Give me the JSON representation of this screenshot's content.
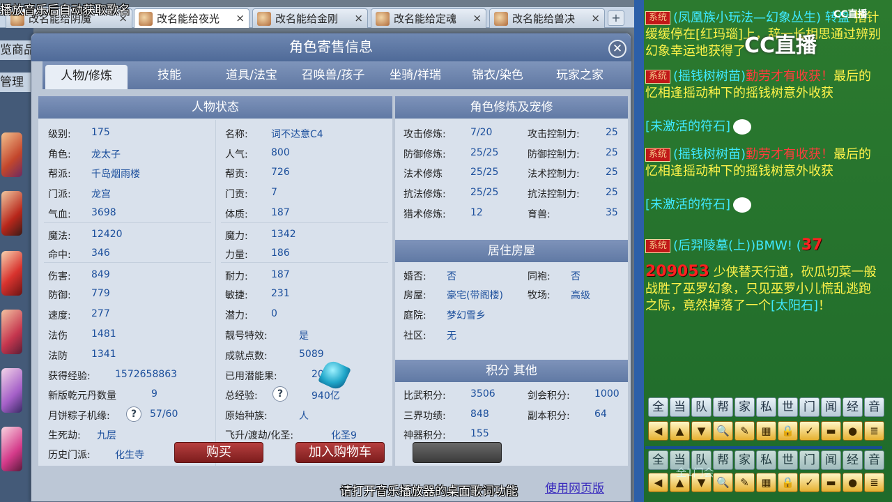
{
  "overlay": {
    "top_text": "播放音乐后自动获取歌名",
    "bottom_text": "请打开音乐播放器的桌面歌词功能"
  },
  "browser": {
    "tabs": [
      {
        "label": "改名能给阴魔"
      },
      {
        "label": "改名能给夜光"
      },
      {
        "label": "改名能给金刚"
      },
      {
        "label": "改名能给定魂"
      },
      {
        "label": "改名能给兽决"
      }
    ],
    "new_tab": "+",
    "close": "×"
  },
  "left_partial": {
    "label1": "览商品",
    "label2": "管理"
  },
  "dialog": {
    "title": "角色寄售信息",
    "close": "✕",
    "tabs": [
      "人物/修炼",
      "技能",
      "道具/法宝",
      "召唤兽/孩子",
      "坐骑/祥瑞",
      "锦衣/染色",
      "玩家之家"
    ],
    "status_header": "人物状态",
    "status_left": [
      {
        "label": "级别:",
        "value": "175"
      },
      {
        "label": "角色:",
        "value": "龙太子"
      },
      {
        "label": "帮派:",
        "value": "千岛烟雨楼"
      },
      {
        "label": "门派:",
        "value": "龙宫"
      },
      {
        "label": "气血:",
        "value": "3698"
      },
      {
        "label": "魔法:",
        "value": "12420"
      },
      {
        "label": "命中:",
        "value": "346"
      },
      {
        "label": "伤害:",
        "value": "849"
      },
      {
        "label": "防御:",
        "value": "779"
      },
      {
        "label": "速度:",
        "value": "277"
      },
      {
        "label": "法伤",
        "value": "1481"
      },
      {
        "label": "法防",
        "value": "1341"
      },
      {
        "label": "获得经验:",
        "value": "1572658863"
      },
      {
        "label": "新版乾元丹数量",
        "value": "9"
      },
      {
        "label": "月饼粽子机缘:",
        "value": "57/60"
      },
      {
        "label": "生死劫:",
        "value": "九层"
      },
      {
        "label": "历史门派:",
        "value": "化生寺"
      }
    ],
    "status_right": [
      {
        "label": "名称:",
        "value": "词不达意C4"
      },
      {
        "label": "人气:",
        "value": "800"
      },
      {
        "label": "帮贡:",
        "value": "726"
      },
      {
        "label": "门贡:",
        "value": "7"
      },
      {
        "label": "体质:",
        "value": "187"
      },
      {
        "label": "魔力:",
        "value": "1342"
      },
      {
        "label": "力量:",
        "value": "186"
      },
      {
        "label": "耐力:",
        "value": "187"
      },
      {
        "label": "敏捷:",
        "value": "231"
      },
      {
        "label": "潜力:",
        "value": "0"
      },
      {
        "label": "靓号特效:",
        "value": "是"
      },
      {
        "label": "成就点数:",
        "value": "5089"
      },
      {
        "label": "已用潜能果:",
        "value": "200"
      },
      {
        "label": "总经验:",
        "value": "940亿"
      },
      {
        "label": "原始种族:",
        "value": "人"
      },
      {
        "label": "飞升/渡劫/化圣:",
        "value": "化圣9"
      }
    ],
    "help_mark": "?",
    "cultivation_header": "角色修炼及宠修",
    "cultivation": [
      {
        "label": "攻击修炼:",
        "value": "7/20",
        "label2": "攻击控制力:",
        "value2": "25"
      },
      {
        "label": "防御修炼:",
        "value": "25/25",
        "label2": "防御控制力:",
        "value2": "25"
      },
      {
        "label": "法术修炼",
        "value": "25/25",
        "label2": "法术控制力:",
        "value2": "25"
      },
      {
        "label": "抗法修炼:",
        "value": "25/25",
        "label2": "抗法控制力:",
        "value2": "25"
      },
      {
        "label": "猎术修炼:",
        "value": "12",
        "label2": "育兽:",
        "value2": "35"
      }
    ],
    "house_header": "居住房屋",
    "house": [
      {
        "label": "婚否:",
        "value": "否",
        "label2": "同袍:",
        "value2": "否"
      },
      {
        "label": "房屋:",
        "value": "豪宅(带阁楼)",
        "label2": "牧场:",
        "value2": "高级"
      },
      {
        "label": "庭院:",
        "value": "梦幻雪乡"
      },
      {
        "label": "社区:",
        "value": "无"
      }
    ],
    "score_header": "积分 其他",
    "score": [
      {
        "label": "比武积分:",
        "value": "3506",
        "label2": "剑会积分:",
        "value2": "1000"
      },
      {
        "label": "三界功绩:",
        "value": "848",
        "label2": "副本积分:",
        "value2": "64"
      },
      {
        "label": "神器积分:",
        "value": "155"
      }
    ],
    "buy_button": "购买",
    "cart_button": "加入购物车",
    "web_link": "使用网页版"
  },
  "chat": {
    "logo": "CC直播",
    "mini_logo": "CC直播",
    "system_badge": "系统",
    "messages": [
      {
        "head": "(凤凰族小玩法—幻象丛生) 转盘",
        "body": "指针缓缓停在[红玛瑙]上，辞一长相思通过辨别幻象幸运地获得了"
      },
      {
        "head": "(摇钱树树苗)",
        "hl": "勤劳才有收获！",
        "tail": "最后的忆相逢",
        "body": "摇动种下的摇钱树意外收获",
        "item": "[未激活的符石]"
      },
      {
        "head": "(摇钱树树苗)",
        "hl": "勤劳才有收获！",
        "tail": "最后的忆相逢",
        "body": "摇动种下的摇钱树意外收获",
        "item": "[未激活的符石]"
      },
      {
        "head": "(后羿陵墓(上))BMW! (",
        "num": "37",
        "player": "209053",
        "body": "少侠替天行道，砍瓜切菜一般战胜了巫罗幻象，只见巫罗小儿慌乱逃跑之际，竟然掉落了一个",
        "item": "[太阳石]",
        "end": "！"
      }
    ],
    "channels": [
      "全",
      "当",
      "队",
      "帮",
      "家",
      "私",
      "世",
      "门",
      "闻",
      "经",
      "音"
    ],
    "icons": [
      {
        "name": "arrow-left-icon",
        "glyph": "◀"
      },
      {
        "name": "arrow-up-icon",
        "glyph": "▲"
      },
      {
        "name": "arrow-down-icon",
        "glyph": "▼"
      },
      {
        "name": "magnifier-icon",
        "glyph": "🔍"
      },
      {
        "name": "note-icon",
        "glyph": "✎"
      },
      {
        "name": "grid-icon",
        "glyph": "▦"
      },
      {
        "name": "lock-icon",
        "glyph": "🔒"
      },
      {
        "name": "brush-icon",
        "glyph": "✓"
      },
      {
        "name": "folder-icon",
        "glyph": "▬"
      },
      {
        "name": "speech-icon",
        "glyph": "●"
      },
      {
        "name": "list-icon",
        "glyph": "≣"
      }
    ],
    "ghost_text": "全1门会"
  }
}
